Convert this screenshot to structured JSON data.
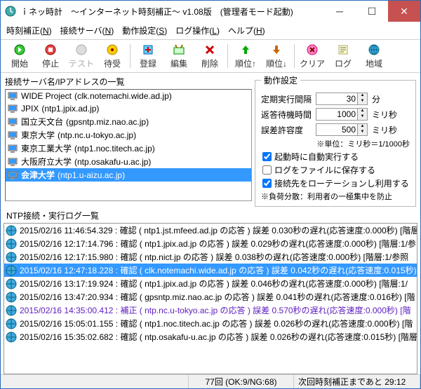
{
  "window": {
    "title": "ｉネッ時計　～インターネット時刻補正～ v1.08版　(管理者モード起動)"
  },
  "menu": {
    "m0": "時刻補正(<u>N</u>)",
    "m1": "接続サーバ(<u>N</u>)",
    "m2": "動作設定(<u>S</u>)",
    "m3": "ログ操作(<u>L</u>)",
    "m4": "ヘルプ(<u>H</u>)"
  },
  "toolbar": {
    "b0": "開始",
    "b1": "停止",
    "b2": "テスト",
    "b3": "待受",
    "b4": "登録",
    "b5": "編集",
    "b6": "削除",
    "b7": "順位↑",
    "b8": "順位↓",
    "b9": "クリア",
    "b10": "ログ",
    "b11": "地域"
  },
  "serversLabel": "接続サーバ名/IPアドレスの一覧",
  "servers": [
    {
      "name": "WIDE Project",
      "host": "(clk.notemachi.wide.ad.jp)"
    },
    {
      "name": "JPIX",
      "host": "(ntp1.jpix.ad.jp)"
    },
    {
      "name": "国立天文台",
      "host": "(gpsntp.miz.nao.ac.jp)"
    },
    {
      "name": "東京大学",
      "host": "(ntp.nc.u-tokyo.ac.jp)"
    },
    {
      "name": "東京工業大学",
      "host": "(ntp1.noc.titech.ac.jp)"
    },
    {
      "name": "大阪府立大学",
      "host": "(ntp.osakafu-u.ac.jp)"
    },
    {
      "name": "会津大学",
      "host": "(ntp1.u-aizu.ac.jp)"
    }
  ],
  "opts": {
    "legend": "動作設定",
    "r0l": "定期実行間隔",
    "r0v": "30",
    "r0u": "分",
    "r1l": "返答待機時間",
    "r1v": "1000",
    "r1u": "ミリ秒",
    "r2l": "誤差許容度",
    "r2v": "500",
    "r2u": "ミリ秒",
    "note1": "※単位：ミリ秒＝1/1000秒",
    "c0": "起動時に自動実行する",
    "c1": "ログをファイルに保存する",
    "c2": "接続先をローテーションし利用する",
    "note2": "※負荷分散：利用者の一極集中を防止"
  },
  "logLabel": "NTP接続・実行ログ一覧",
  "logs": [
    "2015/02/16 11:46:54.329 : 確認   ( ntp1.jst.mfeed.ad.jp の応答 ) 誤差 0.030秒の遅れ(応答速度:0.000秒) [階層",
    "2015/02/16 12:17:14.796 : 確認   ( ntp1.jpix.ad.jp の応答 ) 誤差 0.029秒の遅れ(応答速度:0.000秒) [階層:1/参",
    "2015/02/16 12:17:15.980 : 確認   ( ntp.nict.jp の応答 ) 誤差 0.038秒の遅れ(応答速度:0.000秒) [階層:1/参照",
    "2015/02/16 12:47:18.228 : 確認   ( clk.notemachi.wide.ad.jp の応答 ) 誤差 0.042秒の遅れ(応答速度:0.015秒)",
    "2015/02/16 13:17:19.924 : 確認   ( ntp1.jpix.ad.jp の応答 ) 誤差 0.046秒の遅れ(応答速度:0.000秒) [階層:1/",
    "2015/02/16 13:47:20.934 : 確認   ( gpsntp.miz.nao.ac.jp の応答 ) 誤差 0.041秒の遅れ(応答速度:0.016秒) [階",
    "2015/02/16 14:35:00.412 : 補正   ( ntp.nc.u-tokyo.ac.jp の応答 ) 誤差 0.570秒の遅れ(応答速度:0.000秒) [階",
    "2015/02/16 15:05:01.155 : 確認   ( ntp1.noc.titech.ac.jp の応答 ) 誤差 0.026秒の遅れ(応答速度:0.000秒) [階",
    "2015/02/16 15:35:02.682 : 確認   ( ntp.osakafu-u.ac.jp の応答 ) 誤差 0.026秒の遅れ(応答速度:0.015秒) [階層"
  ],
  "status": {
    "mid": "77回 (OK:9/NG:68)",
    "right": "次回時刻補正まであと 29:12"
  }
}
